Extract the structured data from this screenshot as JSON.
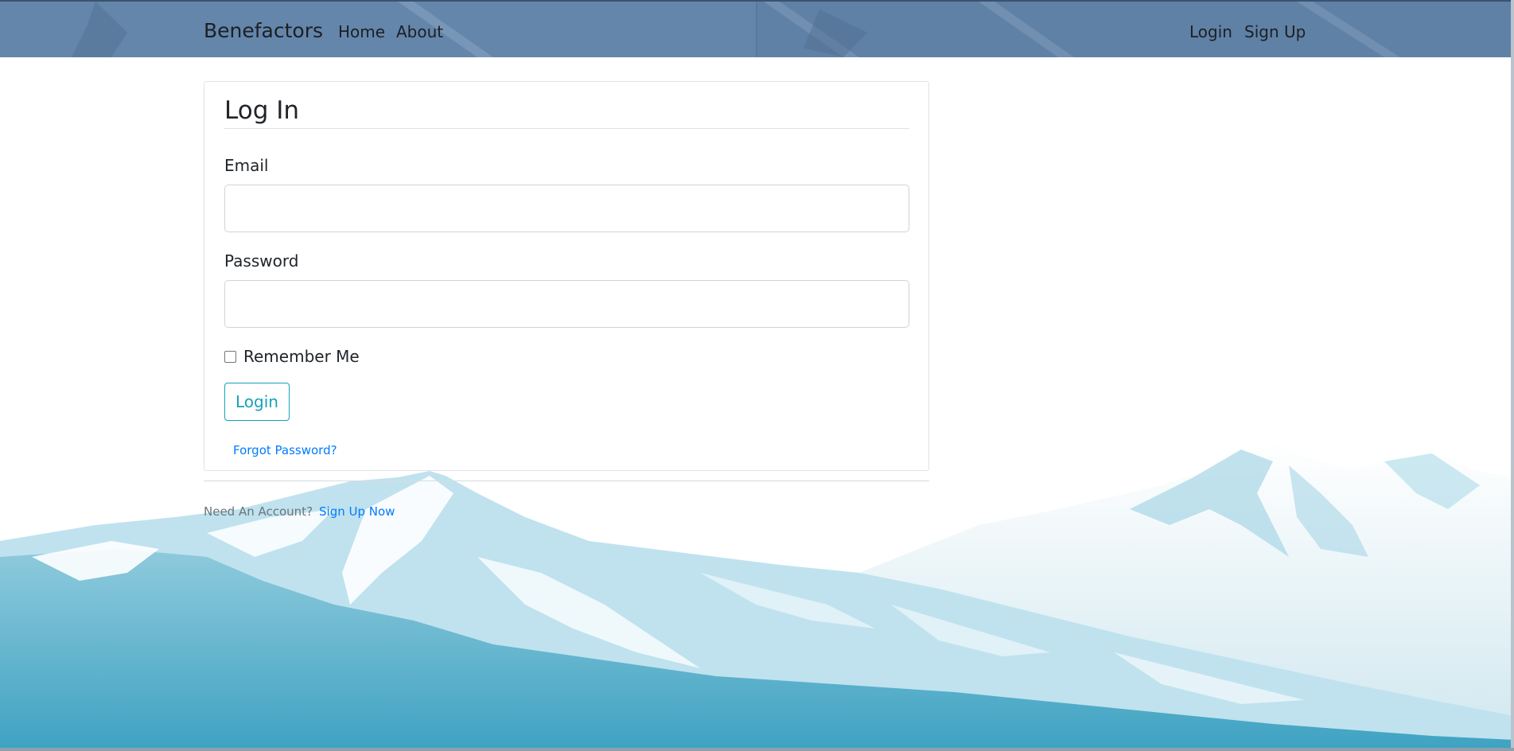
{
  "navbar": {
    "brand": "Benefactors",
    "left_links": [
      {
        "label": "Home"
      },
      {
        "label": "About"
      }
    ],
    "right_links": [
      {
        "label": "Login"
      },
      {
        "label": "Sign Up"
      }
    ]
  },
  "login_form": {
    "title": "Log In",
    "email": {
      "label": "Email",
      "value": "",
      "placeholder": ""
    },
    "password": {
      "label": "Password",
      "value": "",
      "placeholder": ""
    },
    "remember_me": {
      "label": "Remember Me",
      "checked": false
    },
    "submit_label": "Login",
    "forgot_password_label": "Forgot Password?"
  },
  "footer": {
    "prompt": "Need An Account?",
    "signup_link": "Sign Up Now"
  },
  "colors": {
    "navbar_bg": "#5f81a5",
    "button_accent": "#17a2b8",
    "link": "#007bff",
    "mountain_dark": "#46a6c4",
    "mountain_light": "#d9eef5"
  }
}
